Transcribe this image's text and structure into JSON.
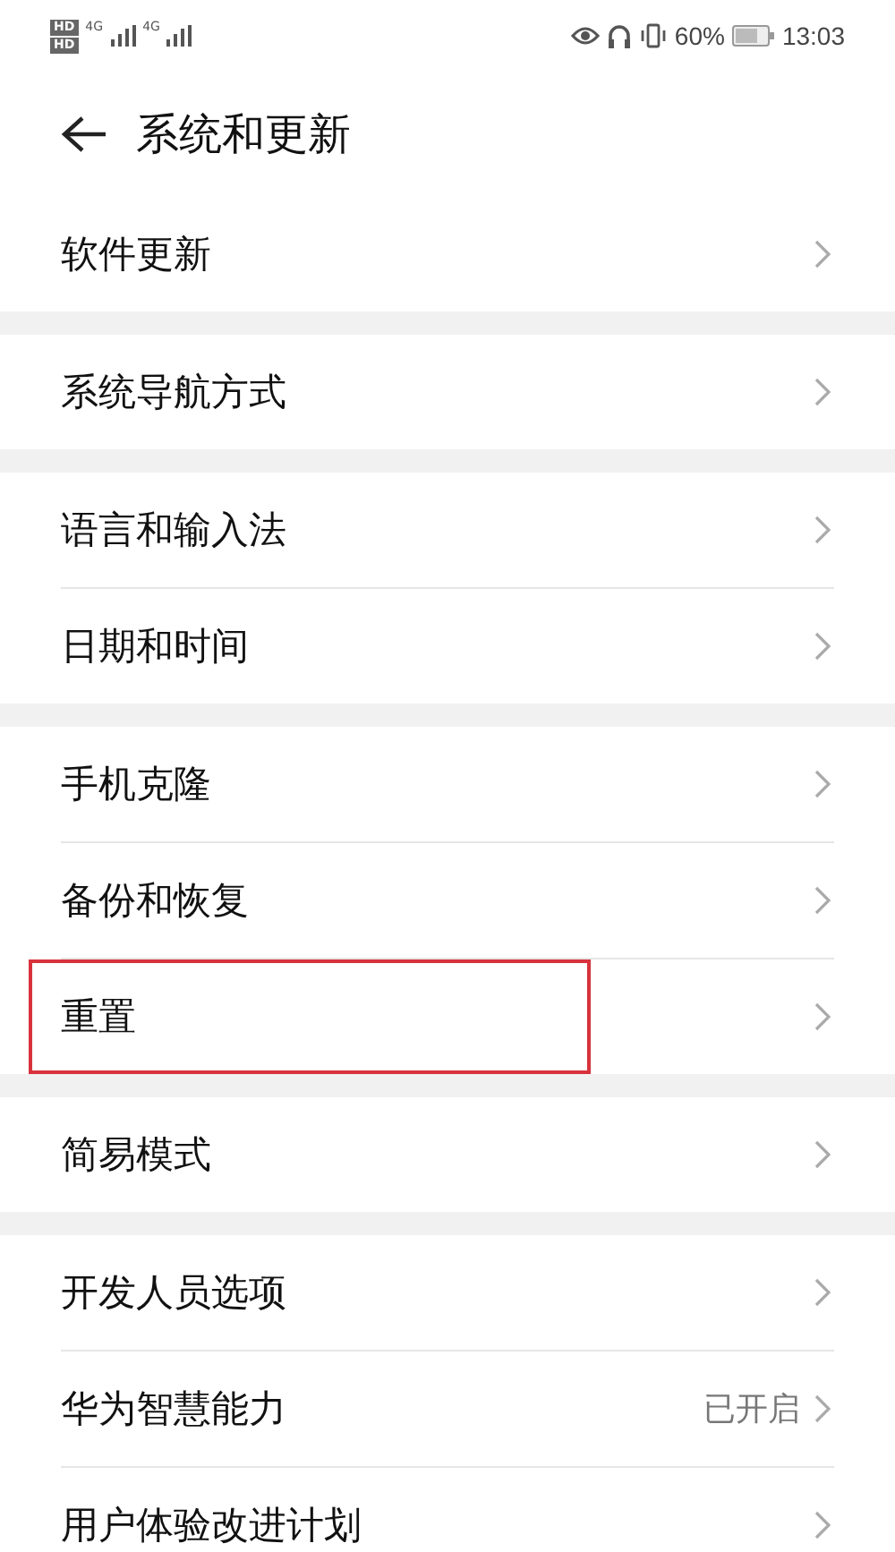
{
  "status_bar": {
    "sims": [
      {
        "hd": "HD",
        "network": "4G"
      },
      {
        "hd": "HD",
        "network": "4G"
      }
    ],
    "battery_percent": "60%",
    "time": "13:03"
  },
  "header": {
    "title": "系统和更新"
  },
  "groups": [
    {
      "items": [
        {
          "label": "软件更新",
          "highlighted": false
        }
      ]
    },
    {
      "items": [
        {
          "label": "系统导航方式",
          "highlighted": false
        }
      ]
    },
    {
      "items": [
        {
          "label": "语言和输入法",
          "highlighted": false
        },
        {
          "label": "日期和时间",
          "highlighted": false
        }
      ]
    },
    {
      "items": [
        {
          "label": "手机克隆",
          "highlighted": false
        },
        {
          "label": "备份和恢复",
          "highlighted": false
        },
        {
          "label": "重置",
          "highlighted": true
        }
      ]
    },
    {
      "items": [
        {
          "label": "简易模式",
          "highlighted": false
        }
      ]
    },
    {
      "items": [
        {
          "label": "开发人员选项",
          "highlighted": false
        },
        {
          "label": "华为智慧能力",
          "value": "已开启",
          "highlighted": false
        },
        {
          "label": "用户体验改进计划",
          "highlighted": false
        }
      ]
    }
  ]
}
